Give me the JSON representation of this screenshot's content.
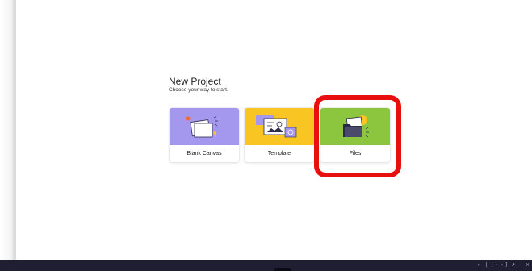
{
  "header": {
    "title": "New Project",
    "subtitle": "Choose your way to start."
  },
  "cards": [
    {
      "label": "Blank Canvas",
      "thumb_color": "#a397ee",
      "icon": "blank-canvas-illustration-icon"
    },
    {
      "label": "Template",
      "thumb_color": "#f8c523",
      "icon": "template-illustration-icon"
    },
    {
      "label": "Files",
      "thumb_color": "#8bc63e",
      "icon": "folder-files-illustration-icon"
    }
  ],
  "annotation": {
    "color": "#e8100e",
    "target": "Files"
  },
  "taskbar": {
    "background": "#1f1e33",
    "controls": [
      {
        "glyph": "←",
        "icon": "back-arrow-icon"
      },
      {
        "glyph": "|",
        "icon": "divider-icon"
      },
      {
        "glyph": "[→",
        "icon": "enter-icon"
      },
      {
        "glyph": "←]",
        "icon": "exit-icon"
      },
      {
        "glyph": "↗",
        "icon": "expand-icon"
      },
      {
        "glyph": "–",
        "icon": "minimize-icon"
      },
      {
        "glyph": "×",
        "icon": "close-icon"
      }
    ]
  }
}
